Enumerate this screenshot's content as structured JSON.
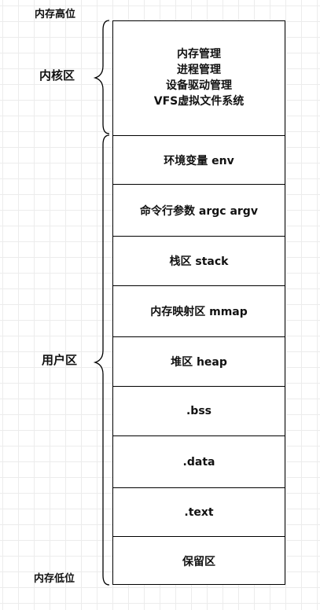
{
  "labels": {
    "high_address": "内存高位",
    "low_address": "内存低位",
    "kernel_space": "内核区",
    "user_space": "用户区"
  },
  "kernel": {
    "lines": [
      "内存管理",
      "进程管理",
      "设备驱动管理",
      "VFS虚拟文件系统"
    ]
  },
  "user_segments": [
    "环境变量 env",
    "命令行参数 argc argv",
    "栈区 stack",
    "内存映射区 mmap",
    "堆区 heap",
    ".bss",
    ".data",
    ".text",
    "保留区"
  ]
}
